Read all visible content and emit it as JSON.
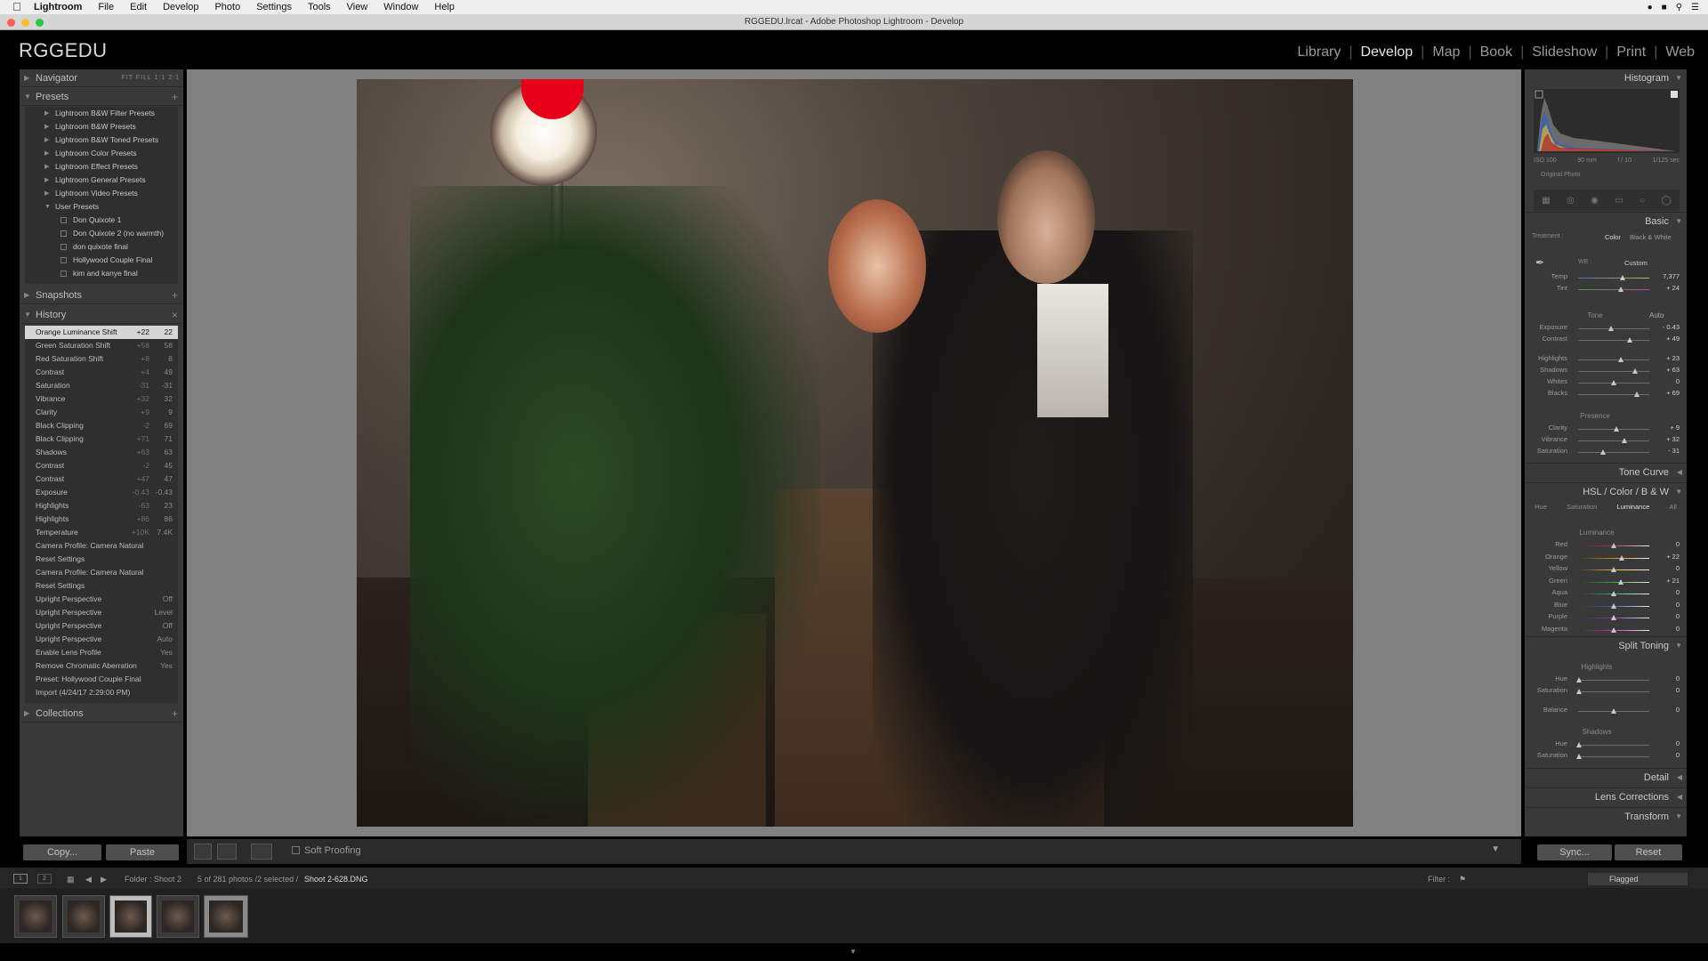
{
  "menubar": {
    "app": "Lightroom",
    "items": [
      "File",
      "Edit",
      "Develop",
      "Photo",
      "Settings",
      "Tools",
      "View",
      "Window",
      "Help"
    ]
  },
  "window": {
    "title": "RGGEDU.lrcat - Adobe Photoshop Lightroom - Develop"
  },
  "brand": "RGGEDU",
  "modules": [
    "Library",
    "Develop",
    "Map",
    "Book",
    "Slideshow",
    "Print",
    "Web"
  ],
  "active_module": "Develop",
  "left": {
    "navigator": {
      "title": "Navigator",
      "options": "FIT  FILL  1:1  2:1"
    },
    "presets": {
      "title": "Presets",
      "items": [
        {
          "label": "Lightroom B&W Filter Presets"
        },
        {
          "label": "Lightroom B&W Presets"
        },
        {
          "label": "Lightroom B&W Toned Presets"
        },
        {
          "label": "Lightroom Color Presets"
        },
        {
          "label": "Lightroom Effect Presets"
        },
        {
          "label": "Lightroom General Presets"
        },
        {
          "label": "Lightroom Video Presets"
        },
        {
          "label": "User Presets"
        },
        {
          "label": "Don Quixote 1"
        },
        {
          "label": "Don Quixote 2 (no warmth)"
        },
        {
          "label": "don quixote final"
        },
        {
          "label": "Hollywood Couple Final"
        },
        {
          "label": "kim and kanye final"
        }
      ]
    },
    "snapshots": {
      "title": "Snapshots"
    },
    "history": {
      "title": "History",
      "items": [
        {
          "label": "Orange Luminance Shift",
          "delta": "+22",
          "value": "22"
        },
        {
          "label": "Green Saturation Shift",
          "delta": "+58",
          "value": "58"
        },
        {
          "label": "Red Saturation Shift",
          "delta": "+8",
          "value": "8"
        },
        {
          "label": "Contrast",
          "delta": "+4",
          "value": "49"
        },
        {
          "label": "Saturation",
          "delta": "-31",
          "value": "-31"
        },
        {
          "label": "Vibrance",
          "delta": "+32",
          "value": "32"
        },
        {
          "label": "Clarity",
          "delta": "+9",
          "value": "9"
        },
        {
          "label": "Black Clipping",
          "delta": "-2",
          "value": "69"
        },
        {
          "label": "Black Clipping",
          "delta": "+71",
          "value": "71"
        },
        {
          "label": "Shadows",
          "delta": "+63",
          "value": "63"
        },
        {
          "label": "Contrast",
          "delta": "-2",
          "value": "45"
        },
        {
          "label": "Contrast",
          "delta": "+47",
          "value": "47"
        },
        {
          "label": "Exposure",
          "delta": "-0.43",
          "value": "-0.43"
        },
        {
          "label": "Highlights",
          "delta": "-63",
          "value": "23"
        },
        {
          "label": "Highlights",
          "delta": "+86",
          "value": "86"
        },
        {
          "label": "Temperature",
          "delta": "+10K",
          "value": "7.4K"
        },
        {
          "label": "Camera Profile: Camera Natural",
          "delta": "",
          "value": ""
        },
        {
          "label": "Reset Settings",
          "delta": "",
          "value": ""
        },
        {
          "label": "Camera Profile: Camera Natural",
          "delta": "",
          "value": ""
        },
        {
          "label": "Reset Settings",
          "delta": "",
          "value": ""
        },
        {
          "label": "Upright Perspective",
          "delta": "",
          "value": "Off"
        },
        {
          "label": "Upright Perspective",
          "delta": "",
          "value": "Level"
        },
        {
          "label": "Upright Perspective",
          "delta": "",
          "value": "Off"
        },
        {
          "label": "Upright Perspective",
          "delta": "",
          "value": "Auto"
        },
        {
          "label": "Enable Lens Profile",
          "delta": "",
          "value": "Yes"
        },
        {
          "label": "Remove Chromatic Aberration",
          "delta": "",
          "value": "Yes"
        },
        {
          "label": "Preset: Hollywood Couple Final",
          "delta": "",
          "value": ""
        },
        {
          "label": "Import (4/24/17 2:29:00 PM)",
          "delta": "",
          "value": ""
        }
      ]
    },
    "collections": {
      "title": "Collections"
    },
    "copy_label": "Copy...",
    "paste_label": "Paste"
  },
  "toolbar": {
    "soft_proofing": "Soft Proofing"
  },
  "right": {
    "histogram": {
      "title": "Histogram",
      "iso": "ISO 100",
      "focal": "90 mm",
      "aperture": "f / 10",
      "shutter": "1/125 sec",
      "original": "Original Photo"
    },
    "basic": {
      "title": "Basic",
      "treatment_label": "Treatment :",
      "color": "Color",
      "bw": "Black & White",
      "wb_label": "WB :",
      "wb_value": "Custom",
      "temp": {
        "label": "Temp",
        "value": "7,377",
        "pos": 0.62
      },
      "tint": {
        "label": "Tint",
        "value": "+ 24",
        "pos": 0.6
      },
      "tone_label": "Tone",
      "auto": "Auto",
      "sliders": [
        {
          "label": "Exposure",
          "value": "- 0.43",
          "pos": 0.46
        },
        {
          "label": "Contrast",
          "value": "+ 49",
          "pos": 0.73
        },
        {
          "label": "Highlights",
          "value": "+ 23",
          "pos": 0.6
        },
        {
          "label": "Shadows",
          "value": "+ 63",
          "pos": 0.8
        },
        {
          "label": "Whites",
          "value": "0",
          "pos": 0.5
        },
        {
          "label": "Blacks",
          "value": "+ 69",
          "pos": 0.82
        }
      ],
      "presence_label": "Presence",
      "presence": [
        {
          "label": "Clarity",
          "value": "+ 9",
          "pos": 0.54
        },
        {
          "label": "Vibrance",
          "value": "+ 32",
          "pos": 0.65
        },
        {
          "label": "Saturation",
          "value": "- 31",
          "pos": 0.35
        }
      ]
    },
    "tone_curve": "Tone Curve",
    "hsl": {
      "title": "HSL",
      "color": "Color",
      "bw": "B & W",
      "tabs": [
        "Hue",
        "Saturation",
        "Luminance",
        "All"
      ],
      "active_tab": "Luminance",
      "luminance_label": "Luminance",
      "sliders": [
        {
          "label": "Red",
          "value": "0",
          "pos": 0.5
        },
        {
          "label": "Orange",
          "value": "+ 22",
          "pos": 0.61
        },
        {
          "label": "Yellow",
          "value": "0",
          "pos": 0.5
        },
        {
          "label": "Green",
          "value": "+ 21",
          "pos": 0.6
        },
        {
          "label": "Aqua",
          "value": "0",
          "pos": 0.5
        },
        {
          "label": "Blue",
          "value": "0",
          "pos": 0.5
        },
        {
          "label": "Purple",
          "value": "0",
          "pos": 0.5
        },
        {
          "label": "Magenta",
          "value": "0",
          "pos": 0.5
        }
      ]
    },
    "split_toning": {
      "title": "Split Toning",
      "highlights_label": "Highlights",
      "shadows_label": "Shadows",
      "hue": "Hue",
      "saturation": "Saturation",
      "balance": "Balance",
      "values": [
        "0",
        "0",
        "0",
        "0",
        "0"
      ]
    },
    "detail": "Detail",
    "lens": "Lens Corrections",
    "transform": "Transform",
    "sync_label": "Sync...",
    "reset_label": "Reset"
  },
  "statusbar": {
    "folder": "Folder : Shoot 2",
    "count": "5 of 281 photos /2 selected /",
    "file": "Shoot 2-628.DNG",
    "filter": "Filter :",
    "flag": "Flagged"
  },
  "colors": {
    "panel": "#393939",
    "center": "#818181",
    "accent": "#e6001a"
  }
}
